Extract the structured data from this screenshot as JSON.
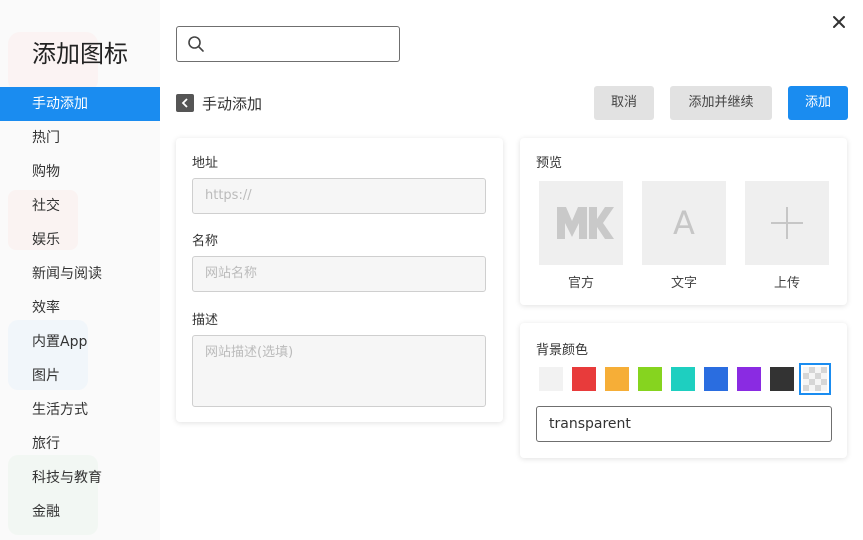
{
  "sidebar": {
    "title": "添加图标",
    "items": [
      {
        "label": "手动添加",
        "active": true
      },
      {
        "label": "热门"
      },
      {
        "label": "购物"
      },
      {
        "label": "社交"
      },
      {
        "label": "娱乐"
      },
      {
        "label": "新闻与阅读"
      },
      {
        "label": "效率"
      },
      {
        "label": "内置App"
      },
      {
        "label": "图片"
      },
      {
        "label": "生活方式"
      },
      {
        "label": "旅行"
      },
      {
        "label": "科技与教育"
      },
      {
        "label": "金融"
      }
    ]
  },
  "search": {
    "placeholder": "",
    "value": ""
  },
  "header": {
    "title": "手动添加",
    "cancel_label": "取消",
    "continue_label": "添加并继续",
    "add_label": "添加"
  },
  "form": {
    "url_label": "地址",
    "url_placeholder": "https://",
    "name_label": "名称",
    "name_placeholder": "网站名称",
    "desc_label": "描述",
    "desc_placeholder": "网站描述(选填)"
  },
  "preview": {
    "title": "预览",
    "options": [
      {
        "label": "官方",
        "glyph": "MK"
      },
      {
        "label": "文字",
        "glyph": "A"
      },
      {
        "label": "上传",
        "glyph": "+"
      }
    ]
  },
  "background": {
    "title": "背景颜色",
    "swatches": [
      "#f2f2f2",
      "#e83b3b",
      "#f6ae37",
      "#86d41f",
      "#1ecfc0",
      "#2a6de0",
      "#8a2be2",
      "#333333",
      "transparent"
    ],
    "selected": "transparent",
    "value": "transparent"
  },
  "accent": "#1a8cf0"
}
